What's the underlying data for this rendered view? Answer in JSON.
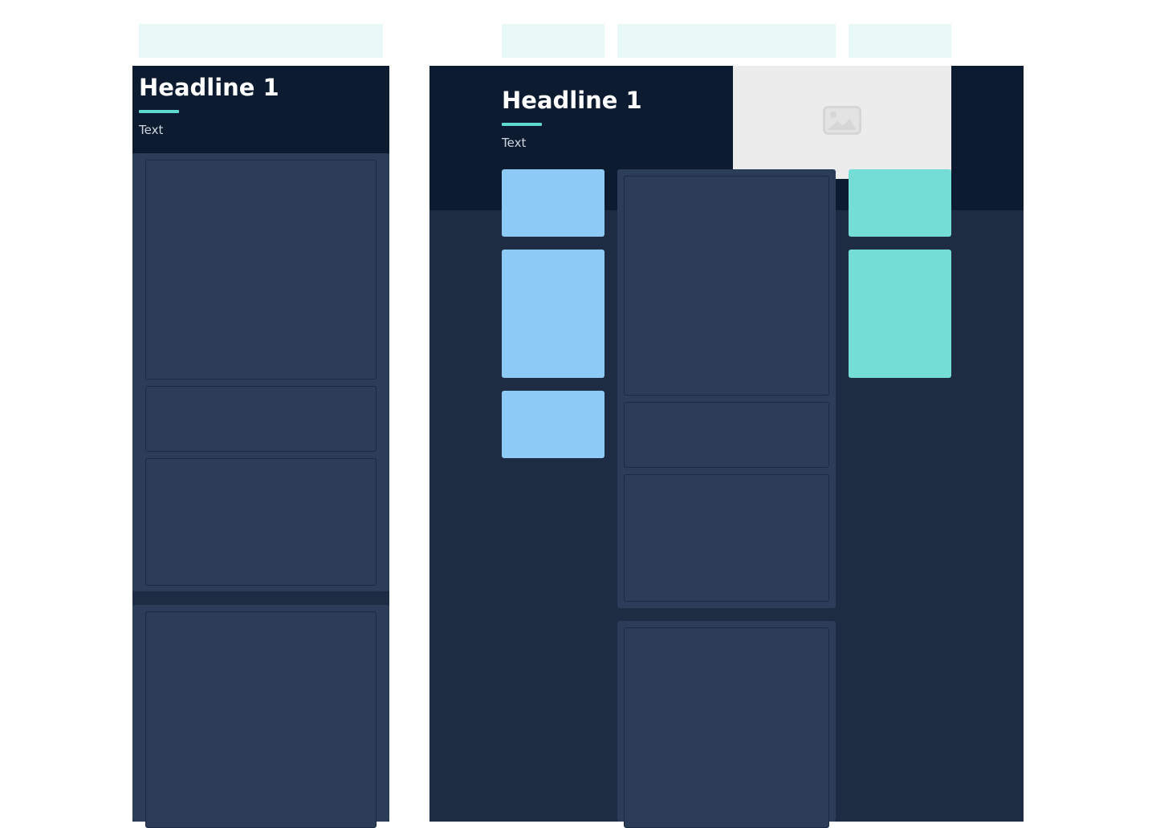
{
  "mobile": {
    "headline": "Headline 1",
    "text": "Text"
  },
  "desktop": {
    "headline": "Headline 1",
    "text": "Text"
  },
  "icons": {
    "image_placeholder": "image-icon"
  },
  "colors": {
    "header_bg": "#0c1b2f",
    "body_bg": "#1e2c43",
    "panel_bg": "#2c3d59",
    "accent": "#5fd8cf",
    "blue_card": "#8ecaf6",
    "teal_card": "#74ded6",
    "top_placeholder": "#e8f8f6",
    "image_placeholder": "#ececec"
  }
}
